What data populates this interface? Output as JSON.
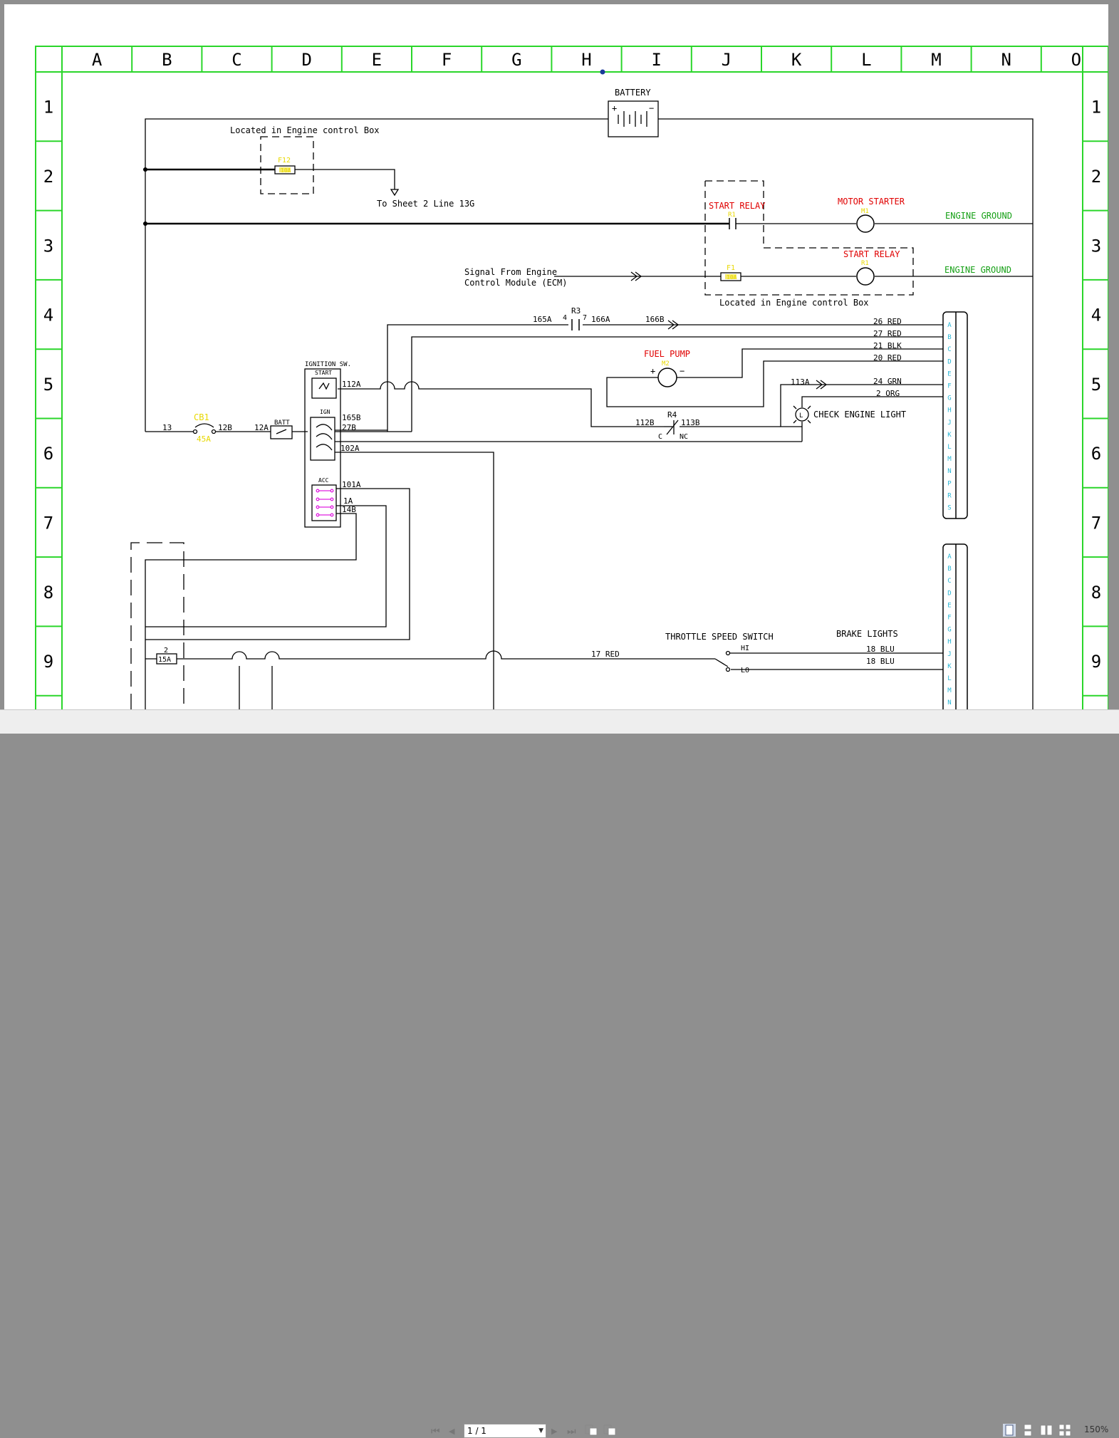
{
  "border": {
    "columns": [
      "A",
      "B",
      "C",
      "D",
      "E",
      "F",
      "G",
      "H",
      "I",
      "J",
      "K",
      "L",
      "M",
      "N",
      "O"
    ],
    "rows": [
      "1",
      "2",
      "3",
      "4",
      "5",
      "6",
      "7",
      "8",
      "9"
    ]
  },
  "colors": {
    "frame": "#2ad62a",
    "wire": "#000000",
    "red": "#e00000",
    "green": "#16a016",
    "yellow": "#e8d800",
    "cyan": "#29b6d6",
    "magenta": "#e020e0"
  },
  "labels": {
    "battery": "BATTERY",
    "battery_plus": "+",
    "battery_minus": "−",
    "located_box_1": "Located in Engine control Box",
    "to_sheet": "To Sheet 2  Line 13G",
    "f12": "F12",
    "f12_rating": "10A",
    "start_relay_1": "START RELAY",
    "start_relay_1_ref": "R1",
    "motor_starter": "MOTOR STARTER",
    "motor_starter_ref": "M1",
    "engine_ground_1": "ENGINE GROUND",
    "start_relay_2": "START RELAY",
    "start_relay_2_ref": "R1",
    "f1": "F1",
    "f1_rating": "10A",
    "engine_ground_2": "ENGINE GROUND",
    "signal_1": "Signal From Engine",
    "signal_2": "Control Module (ECM)",
    "located_box_2": "Located in Engine control Box",
    "r3": "R3",
    "r3_pin4": "4",
    "r3_pin7": "7",
    "w165a": "165A",
    "w166a": "166A",
    "w166b": "166B",
    "w26": "26 RED",
    "w27": "27 RED",
    "w21": "21 BLK",
    "w20": "20 RED",
    "fuel_pump": "FUEL PUMP",
    "fuel_pump_ref": "M2",
    "fp_plus": "+",
    "fp_minus": "−",
    "w113a": "113A",
    "w24": "24 GRN",
    "w2": "2 ORG",
    "check_engine": "CHECK ENGINE LIGHT",
    "lamp_l": "L",
    "r4": "R4",
    "w112b": "112B",
    "w113b": "113B",
    "r4_c": "C",
    "r4_nc": "NC",
    "ign_sw": "IGNITION SW.",
    "ign_start": "START",
    "ign_ign": "IGN",
    "ign_acc": "ACC",
    "w112a": "112A",
    "w165b": "165B",
    "w27b": "27B",
    "w102a": "102A",
    "w101a": "101A",
    "w1a": "1A",
    "w14b": "14B",
    "w13": "13",
    "cb1": "CB1",
    "cb1_rating": "45A",
    "w12b": "12B",
    "w12a": "12A",
    "batt": "BATT",
    "fuse2": "2",
    "fuse2_rating": "15A",
    "w17": "17 RED",
    "throttle": "THROTTLE SPEED SWITCH",
    "hi": "HI",
    "lo": "LO",
    "brake_lights": "BRAKE LIGHTS",
    "w18a": "18 BLU",
    "w18b": "18 BLU"
  },
  "connector_1_pins": [
    "A",
    "B",
    "C",
    "D",
    "E",
    "F",
    "G",
    "H",
    "J",
    "K",
    "L",
    "M",
    "N",
    "P",
    "R",
    "S"
  ],
  "connector_2_pins": [
    "A",
    "B",
    "C",
    "D",
    "E",
    "F",
    "G",
    "H",
    "J",
    "K",
    "L",
    "M",
    "N"
  ],
  "toolbar": {
    "first_page": "⏮",
    "prev_page": "◀",
    "page_value": "1 / 1",
    "next_page": "▶",
    "last_page": "⏭",
    "zoom": "150%"
  }
}
